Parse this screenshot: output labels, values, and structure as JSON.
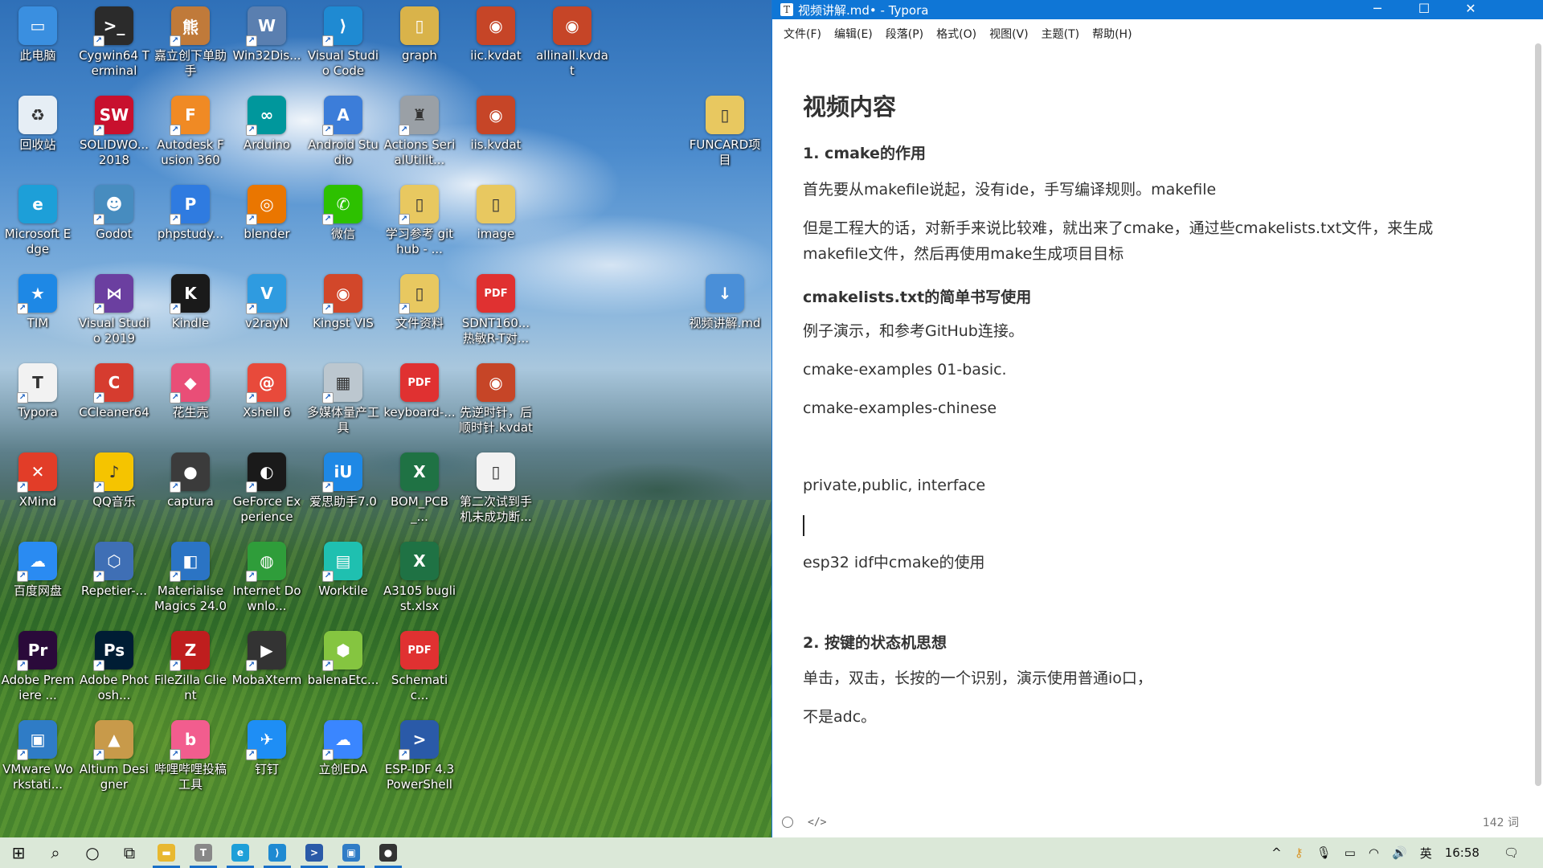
{
  "desktop": {
    "icons": [
      {
        "label": "此电脑",
        "color": "#3a8fe0",
        "glyph": "▭",
        "icon": "computer-icon",
        "shortcut": false
      },
      {
        "label": "Cygwin64 Terminal",
        "color": "#2b2b2b",
        "glyph": ">_",
        "icon": "terminal-icon",
        "shortcut": true
      },
      {
        "label": "嘉立创下单助手",
        "color": "#c07a3a",
        "glyph": "熊",
        "icon": "bear-icon",
        "shortcut": true
      },
      {
        "label": "Win32Dis...",
        "color": "#5a7fb0",
        "glyph": "W",
        "icon": "disk-imager-icon",
        "shortcut": true
      },
      {
        "label": "Visual Studio Code",
        "color": "#1f8ad2",
        "glyph": "⟩",
        "icon": "vscode-icon",
        "shortcut": true
      },
      {
        "label": "graph",
        "color": "#d9b34a",
        "glyph": "▯",
        "icon": "folder-icon",
        "shortcut": false
      },
      {
        "label": "iic.kvdat",
        "color": "#c64527",
        "glyph": "◉",
        "icon": "kingst-file-icon",
        "shortcut": false
      },
      {
        "label": "allinall.kvdat",
        "color": "#c64527",
        "glyph": "◉",
        "icon": "kingst-file-icon",
        "shortcut": false
      },
      {
        "label": "回收站",
        "color": "#e6eef5",
        "glyph": "♻",
        "icon": "recycle-bin-icon",
        "shortcut": false
      },
      {
        "label": "SOLIDWO... 2018",
        "color": "#c8102e",
        "glyph": "SW",
        "icon": "solidworks-icon",
        "shortcut": true
      },
      {
        "label": "Autodesk Fusion 360",
        "color": "#f08a24",
        "glyph": "F",
        "icon": "fusion360-icon",
        "shortcut": true
      },
      {
        "label": "Arduino",
        "color": "#00979c",
        "glyph": "∞",
        "icon": "arduino-icon",
        "shortcut": true
      },
      {
        "label": "Android Studio",
        "color": "#3c7dd9",
        "glyph": "A",
        "icon": "android-studio-icon",
        "shortcut": true
      },
      {
        "label": "Actions SerialUtilit...",
        "color": "#9aa0a6",
        "glyph": "♜",
        "icon": "serial-utility-icon",
        "shortcut": true
      },
      {
        "label": "iis.kvdat",
        "color": "#c64527",
        "glyph": "◉",
        "icon": "kingst-file-icon",
        "shortcut": false
      },
      {
        "label": "FUNCARD项目",
        "color": "#e8c860",
        "glyph": "▯",
        "icon": "folder-icon",
        "shortcut": false
      },
      {
        "label": "Microsoft Edge",
        "color": "#1d9fd8",
        "glyph": "e",
        "icon": "edge-icon",
        "shortcut": false
      },
      {
        "label": "Godot",
        "color": "#478cbf",
        "glyph": "☻",
        "icon": "godot-icon",
        "shortcut": true
      },
      {
        "label": "phpstudy...",
        "color": "#2f7be0",
        "glyph": "P",
        "icon": "phpstudy-icon",
        "shortcut": true
      },
      {
        "label": "blender",
        "color": "#ea7600",
        "glyph": "◎",
        "icon": "blender-icon",
        "shortcut": true
      },
      {
        "label": "微信",
        "color": "#2dc100",
        "glyph": "✆",
        "icon": "wechat-icon",
        "shortcut": true
      },
      {
        "label": "学习参考 github - ...",
        "color": "#e8c860",
        "glyph": "▯",
        "icon": "folder-icon",
        "shortcut": true
      },
      {
        "label": "image",
        "color": "#e8c860",
        "glyph": "▯",
        "icon": "folder-icon",
        "shortcut": false
      },
      {
        "label": "TIM",
        "color": "#1e88e5",
        "glyph": "★",
        "icon": "tim-icon",
        "shortcut": true
      },
      {
        "label": "Visual Studio 2019",
        "color": "#6b3fa0",
        "glyph": "⋈",
        "icon": "visual-studio-icon",
        "shortcut": true
      },
      {
        "label": "Kindle",
        "color": "#1a1a1a",
        "glyph": "K",
        "icon": "kindle-icon",
        "shortcut": true
      },
      {
        "label": "v2rayN",
        "color": "#2f9be0",
        "glyph": "V",
        "icon": "v2rayn-icon",
        "shortcut": true
      },
      {
        "label": "Kingst VIS",
        "color": "#d2472a",
        "glyph": "◉",
        "icon": "kingst-vis-icon",
        "shortcut": true
      },
      {
        "label": "文件资料",
        "color": "#e8c860",
        "glyph": "▯",
        "icon": "folder-icon",
        "shortcut": true
      },
      {
        "label": "SDNT160... 热敏R-T对...",
        "color": "#e03131",
        "glyph": "PDF",
        "icon": "pdf-icon",
        "shortcut": false
      },
      {
        "label": "视频讲解.md",
        "color": "#4a8fd8",
        "glyph": "↓",
        "icon": "markdown-file-icon",
        "shortcut": false
      },
      {
        "label": "Typora",
        "color": "#f2f2f2",
        "glyph": "T",
        "icon": "typora-icon",
        "shortcut": true
      },
      {
        "label": "CCleaner64",
        "color": "#d63c2f",
        "glyph": "C",
        "icon": "ccleaner-icon",
        "shortcut": true
      },
      {
        "label": "花生壳",
        "color": "#e94e77",
        "glyph": "◆",
        "icon": "oray-icon",
        "shortcut": true
      },
      {
        "label": "Xshell 6",
        "color": "#e84a3b",
        "glyph": "@",
        "icon": "xshell-icon",
        "shortcut": true
      },
      {
        "label": "多媒体量产工具",
        "color": "#bcc7cf",
        "glyph": "▦",
        "icon": "media-tool-icon",
        "shortcut": true
      },
      {
        "label": "keyboard-...",
        "color": "#e03131",
        "glyph": "PDF",
        "icon": "pdf-icon",
        "shortcut": false
      },
      {
        "label": "先逆时针，后顺时针.kvdat",
        "color": "#c64527",
        "glyph": "◉",
        "icon": "kingst-file-icon",
        "shortcut": false
      },
      {
        "label": "XMind",
        "color": "#e23d28",
        "glyph": "✕",
        "icon": "xmind-icon",
        "shortcut": true
      },
      {
        "label": "QQ音乐",
        "color": "#f5c400",
        "glyph": "♪",
        "icon": "qq-music-icon",
        "shortcut": true
      },
      {
        "label": "captura",
        "color": "#3b3b3b",
        "glyph": "●",
        "icon": "captura-icon",
        "shortcut": true
      },
      {
        "label": "GeForce Experience",
        "color": "#1a1a1a",
        "glyph": "◐",
        "icon": "nvidia-icon",
        "shortcut": true
      },
      {
        "label": "爱思助手7.0",
        "color": "#1e88e5",
        "glyph": "iU",
        "icon": "i4-assistant-icon",
        "shortcut": true
      },
      {
        "label": "BOM_PCB_...",
        "color": "#1f7244",
        "glyph": "X",
        "icon": "excel-file-icon",
        "shortcut": false
      },
      {
        "label": "第二次试到手机未成功断...",
        "color": "#f2f2f2",
        "glyph": "▯",
        "icon": "text-file-icon",
        "shortcut": false
      },
      {
        "label": "百度网盘",
        "color": "#2a8bf2",
        "glyph": "☁",
        "icon": "baidu-netdisk-icon",
        "shortcut": true
      },
      {
        "label": "Repetier-...",
        "color": "#3f6fb5",
        "glyph": "⬡",
        "icon": "repetier-icon",
        "shortcut": true
      },
      {
        "label": "Materialise Magics 24.0",
        "color": "#2b74c4",
        "glyph": "◧",
        "icon": "magics-icon",
        "shortcut": true
      },
      {
        "label": "Internet Downlo...",
        "color": "#2f9d3a",
        "glyph": "◍",
        "icon": "idm-icon",
        "shortcut": true
      },
      {
        "label": "Worktile",
        "color": "#1fc0b0",
        "glyph": "▤",
        "icon": "worktile-icon",
        "shortcut": true
      },
      {
        "label": "A3105 buglist.xlsx",
        "color": "#1f7244",
        "glyph": "X",
        "icon": "excel-file-icon",
        "shortcut": false
      },
      {
        "label": "Adobe Premiere ...",
        "color": "#2a0a3a",
        "glyph": "Pr",
        "icon": "premiere-icon",
        "shortcut": true
      },
      {
        "label": "Adobe Photosh...",
        "color": "#001d34",
        "glyph": "Ps",
        "icon": "photoshop-icon",
        "shortcut": true
      },
      {
        "label": "FileZilla Client",
        "color": "#bf1e1e",
        "glyph": "Z",
        "icon": "filezilla-icon",
        "shortcut": true
      },
      {
        "label": "MobaXterm",
        "color": "#333333",
        "glyph": "▶",
        "icon": "mobaxterm-icon",
        "shortcut": true
      },
      {
        "label": "balenaEtc...",
        "color": "#85c540",
        "glyph": "⬢",
        "icon": "balena-etcher-icon",
        "shortcut": true
      },
      {
        "label": "Schematic...",
        "color": "#e03131",
        "glyph": "PDF",
        "icon": "pdf-icon",
        "shortcut": false
      },
      {
        "label": "VMware Workstati...",
        "color": "#2f7cc6",
        "glyph": "▣",
        "icon": "vmware-icon",
        "shortcut": true
      },
      {
        "label": "Altium Designer",
        "color": "#c89a4a",
        "glyph": "▲",
        "icon": "altium-icon",
        "shortcut": true
      },
      {
        "label": "哔哩哔哩投稿工具",
        "color": "#f25d8e",
        "glyph": "b",
        "icon": "bilibili-icon",
        "shortcut": true
      },
      {
        "label": "钉钉",
        "color": "#1e8ef5",
        "glyph": "✈",
        "icon": "dingtalk-icon",
        "shortcut": true
      },
      {
        "label": "立创EDA",
        "color": "#3a86ff",
        "glyph": "☁",
        "icon": "lceda-icon",
        "shortcut": true
      },
      {
        "label": "ESP-IDF 4.3 PowerShell",
        "color": "#2a5aa8",
        "glyph": ">",
        "icon": "powershell-icon",
        "shortcut": true
      }
    ]
  },
  "window": {
    "title": "视频讲解.md• - Typora",
    "app_icon": "T",
    "controls": {
      "minimize": "─",
      "maximize": "☐",
      "close": "✕"
    }
  },
  "menu": [
    "文件(F)",
    "编辑(E)",
    "段落(P)",
    "格式(O)",
    "视图(V)",
    "主题(T)",
    "帮助(H)"
  ],
  "doc": {
    "h1": "视频内容",
    "sec1": "1. cmake的作用",
    "p1": "首先要从makefile说起，没有ide，手写编译规则。makefile",
    "p2": "但是工程大的话，对新手来说比较难，就出来了cmake，通过些cmakelists.txt文件，来生成makefile文件，然后再使用make生成项目目标",
    "h_cmakelists": "cmakelists.txt的简单书写使用",
    "p3": "例子演示，和参考GitHub连接。",
    "p4": "cmake-examples 01-basic.",
    "p5": "cmake-examples-chinese",
    "p6": "private,public, interface",
    "p7": "esp32 idf中cmake的使用",
    "sec2": "2. 按键的状态机思想",
    "p8": "单击，双击，长按的一个识别，演示使用普通io口，",
    "p9": "不是adc。"
  },
  "status": {
    "source_mode": "</>",
    "word_count": "142 词"
  },
  "taskbar": {
    "apps": [
      {
        "name": "start-button",
        "glyph": "⊞",
        "color": "#000000",
        "active": false
      },
      {
        "name": "search-button",
        "glyph": "⌕",
        "color": "#000000",
        "active": false
      },
      {
        "name": "cortana-button",
        "glyph": "○",
        "color": "#000000",
        "active": false
      },
      {
        "name": "task-view-button",
        "glyph": "⧉",
        "color": "#000000",
        "active": false
      },
      {
        "name": "taskbar-file-explorer",
        "glyph": "▬",
        "color": "#e8b830",
        "active": true
      },
      {
        "name": "taskbar-typora",
        "glyph": "T",
        "color": "#888888",
        "active": true
      },
      {
        "name": "taskbar-edge",
        "glyph": "e",
        "color": "#1d9fd8",
        "active": true
      },
      {
        "name": "taskbar-vscode",
        "glyph": "⟩",
        "color": "#1f8ad2",
        "active": true
      },
      {
        "name": "taskbar-esp-idf",
        "glyph": ">",
        "color": "#2a5aa8",
        "active": true
      },
      {
        "name": "taskbar-vmware",
        "glyph": "▣",
        "color": "#2f7cc6",
        "active": true
      },
      {
        "name": "taskbar-obs",
        "glyph": "●",
        "color": "#333333",
        "active": true
      }
    ],
    "tray": {
      "chevron": "^",
      "ime": "英",
      "time": "16:58"
    }
  }
}
